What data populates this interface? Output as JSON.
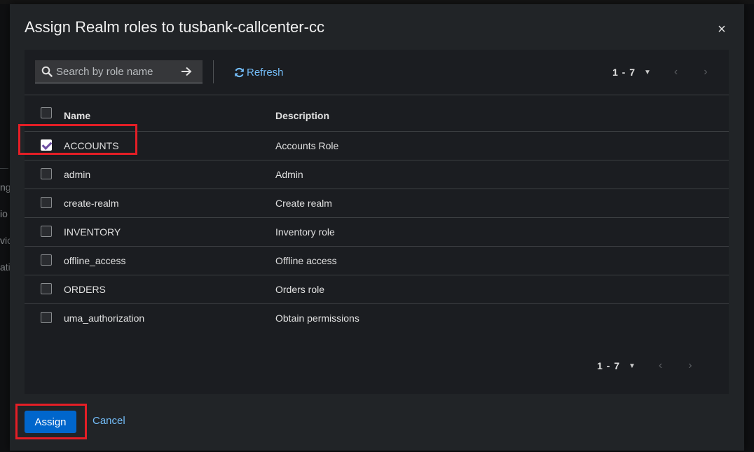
{
  "background": {
    "left_fragments": [
      "ng",
      "io",
      "vic",
      "ati"
    ]
  },
  "modal": {
    "title": "Assign Realm roles to tusbank-callcenter-cc",
    "close_label": "×"
  },
  "toolbar": {
    "search_placeholder": "Search by role name",
    "search_value": "",
    "refresh_label": "Refresh",
    "pagination_top": "1 - 7"
  },
  "table": {
    "columns": [
      "Name",
      "Description"
    ],
    "rows": [
      {
        "name": "ACCOUNTS",
        "description": "Accounts Role",
        "checked": true
      },
      {
        "name": "admin",
        "description": "Admin",
        "checked": false
      },
      {
        "name": "create-realm",
        "description": "Create realm",
        "checked": false
      },
      {
        "name": "INVENTORY",
        "description": "Inventory role",
        "checked": false
      },
      {
        "name": "offline_access",
        "description": "Offline access",
        "checked": false
      },
      {
        "name": "ORDERS",
        "description": "Orders role",
        "checked": false
      },
      {
        "name": "uma_authorization",
        "description": "Obtain permissions",
        "checked": false
      }
    ]
  },
  "pagination_bottom": "1 - 7",
  "footer": {
    "assign_label": "Assign",
    "cancel_label": "Cancel"
  },
  "colors": {
    "accent": "#0066cc",
    "link": "#73bcf7",
    "highlight": "#e41e26",
    "check_mark": "#6e4fa3"
  },
  "icons": {
    "search": "search-icon",
    "go": "arrow-right-icon",
    "refresh": "refresh-icon",
    "close": "close-icon",
    "caret": "caret-down-icon",
    "prev": "angle-left-icon",
    "next": "angle-right-icon"
  }
}
